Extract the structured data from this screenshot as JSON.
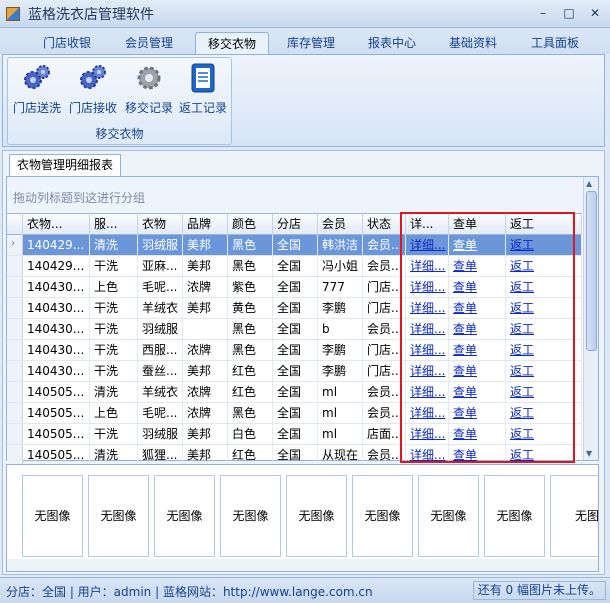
{
  "window": {
    "title": "蓝格洗衣店管理软件",
    "controls": [
      "–",
      "□",
      "✕"
    ]
  },
  "ribbon": {
    "tabs": [
      {
        "label": "门店收银",
        "active": false
      },
      {
        "label": "会员管理",
        "active": false
      },
      {
        "label": "移交衣物",
        "active": true
      },
      {
        "label": "库存管理",
        "active": false
      },
      {
        "label": "报表中心",
        "active": false
      },
      {
        "label": "基础资料",
        "active": false
      },
      {
        "label": "工具面板",
        "active": false
      }
    ],
    "group_label": "移交衣物",
    "buttons": [
      {
        "label": "门店送洗",
        "icon": "gear-blue-icon"
      },
      {
        "label": "门店接收",
        "icon": "gear-blue-icon"
      },
      {
        "label": "移交记录",
        "icon": "gear-gray-icon"
      },
      {
        "label": "返工记录",
        "icon": "document-icon"
      }
    ]
  },
  "doc_tab": "衣物管理明细报表",
  "grid": {
    "group_hint": "拖动列标题到这进行分组",
    "columns": [
      "衣物...",
      "服...",
      "衣物",
      "品牌",
      "颜色",
      "分店",
      "会员",
      "状态",
      "详...",
      "查单",
      "返工"
    ],
    "rows": [
      [
        "140429...",
        "清洗",
        "羽绒服",
        "美邦",
        "黑色",
        "全国",
        "韩洪洁",
        "会员...",
        "详细...",
        "查单",
        "返工"
      ],
      [
        "140429...",
        "干洗",
        "亚麻...",
        "美邦",
        "黑色",
        "全国",
        "冯小姐",
        "会员...",
        "详细...",
        "查单",
        "返工"
      ],
      [
        "140430...",
        "上色",
        "毛呢...",
        "浓牌",
        "紫色",
        "全国",
        "777",
        "门店...",
        "详细...",
        "查单",
        "返工"
      ],
      [
        "140430...",
        "干洗",
        "羊绒衣",
        "美邦",
        "黄色",
        "全国",
        "李鹏",
        "门店...",
        "详细...",
        "查单",
        "返工"
      ],
      [
        "140430...",
        "干洗",
        "羽绒服",
        "",
        "黑色",
        "全国",
        "b",
        "会员...",
        "详细...",
        "查单",
        "返工"
      ],
      [
        "140430...",
        "干洗",
        "西服...",
        "浓牌",
        "黑色",
        "全国",
        "李鹏",
        "门店...",
        "详细...",
        "查单",
        "返工"
      ],
      [
        "140430...",
        "干洗",
        "蚕丝...",
        "美邦",
        "红色",
        "全国",
        "李鹏",
        "门店...",
        "详细...",
        "查单",
        "返工"
      ],
      [
        "140505...",
        "清洗",
        "羊绒衣",
        "浓牌",
        "红色",
        "全国",
        "ml",
        "会员...",
        "详细...",
        "查单",
        "返工"
      ],
      [
        "140505...",
        "上色",
        "毛呢...",
        "浓牌",
        "黑色",
        "全国",
        "ml",
        "会员...",
        "详细...",
        "查单",
        "返工"
      ],
      [
        "140505...",
        "干洗",
        "羽绒服",
        "美邦",
        "白色",
        "全国",
        "ml",
        "店面...",
        "详细...",
        "查单",
        "返工"
      ],
      [
        "140505...",
        "清洗",
        "狐狸...",
        "美邦",
        "红色",
        "全国",
        "从现在",
        "会员...",
        "详细...",
        "查单",
        "返工"
      ]
    ],
    "selected_row": 0
  },
  "images": [
    "无图像",
    "无图像",
    "无图像",
    "无图像",
    "无图像",
    "无图像",
    "无图像",
    "无图像",
    "无图"
  ],
  "status": {
    "left": "分店：全国  |  用户：admin  |  蓝格网站：http://www.lange.com.cn",
    "right": "还有 0 幅图片未上传。"
  },
  "colors": {
    "highlight": "#e0161d",
    "selected_row": "#6b96d9",
    "link": "#0b29c8"
  }
}
